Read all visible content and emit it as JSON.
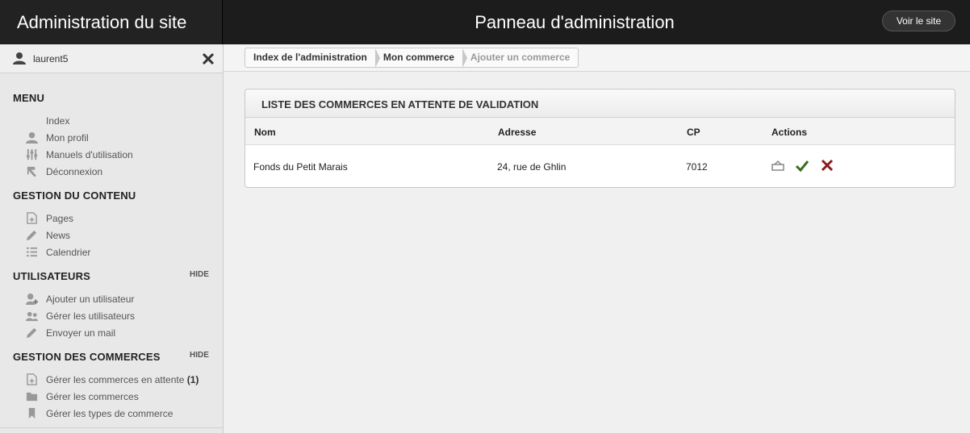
{
  "header": {
    "site_title": "Administration du site",
    "panel_title": "Panneau d'administration",
    "view_site_label": "Voir le site"
  },
  "user": {
    "name": "laurent5"
  },
  "sidebar": {
    "menu": {
      "title": "MENU",
      "items": [
        {
          "label": "Index"
        },
        {
          "label": "Mon profil",
          "icon": "user-icon"
        },
        {
          "label": "Manuels d'utilisation",
          "icon": "sliders-icon"
        },
        {
          "label": "Déconnexion",
          "icon": "logout-icon"
        }
      ]
    },
    "content": {
      "title": "GESTION DU CONTENU",
      "items": [
        {
          "label": "Pages",
          "icon": "page-add-icon"
        },
        {
          "label": "News",
          "icon": "pencil-icon"
        },
        {
          "label": "Calendrier",
          "icon": "list-icon"
        }
      ]
    },
    "users": {
      "title": "UTILISATEURS",
      "hide_label": "HIDE",
      "items": [
        {
          "label": "Ajouter un utilisateur",
          "icon": "user-add-icon"
        },
        {
          "label": "Gérer les utilisateurs",
          "icon": "users-icon"
        },
        {
          "label": "Envoyer un mail",
          "icon": "pencil-icon"
        }
      ]
    },
    "shops": {
      "title": "GESTION DES COMMERCES",
      "hide_label": "HIDE",
      "items": [
        {
          "label": "Gérer les commerces en attente",
          "count": "(1)",
          "icon": "page-add-icon"
        },
        {
          "label": "Gérer les commerces",
          "icon": "folder-icon"
        },
        {
          "label": "Gérer les types de commerce",
          "icon": "bookmark-icon"
        }
      ]
    }
  },
  "breadcrumb": {
    "items": [
      "Index de l'administration",
      "Mon commerce",
      "Ajouter un commerce"
    ]
  },
  "pending_table": {
    "title": "LISTE DES COMMERCES EN ATTENTE DE VALIDATION",
    "columns": [
      "Nom",
      "Adresse",
      "CP",
      "Actions"
    ],
    "rows": [
      {
        "name": "Fonds du Petit Marais",
        "address": "24, rue de Ghlin",
        "cp": "7012",
        "actions": [
          "shop-icon",
          "check-icon",
          "delete-icon"
        ]
      }
    ]
  },
  "colors": {
    "topbar": "#1c1c1c",
    "sidebar": "#e8e8e8",
    "approve": "#3a6e1f",
    "reject": "#8b1a1a"
  }
}
